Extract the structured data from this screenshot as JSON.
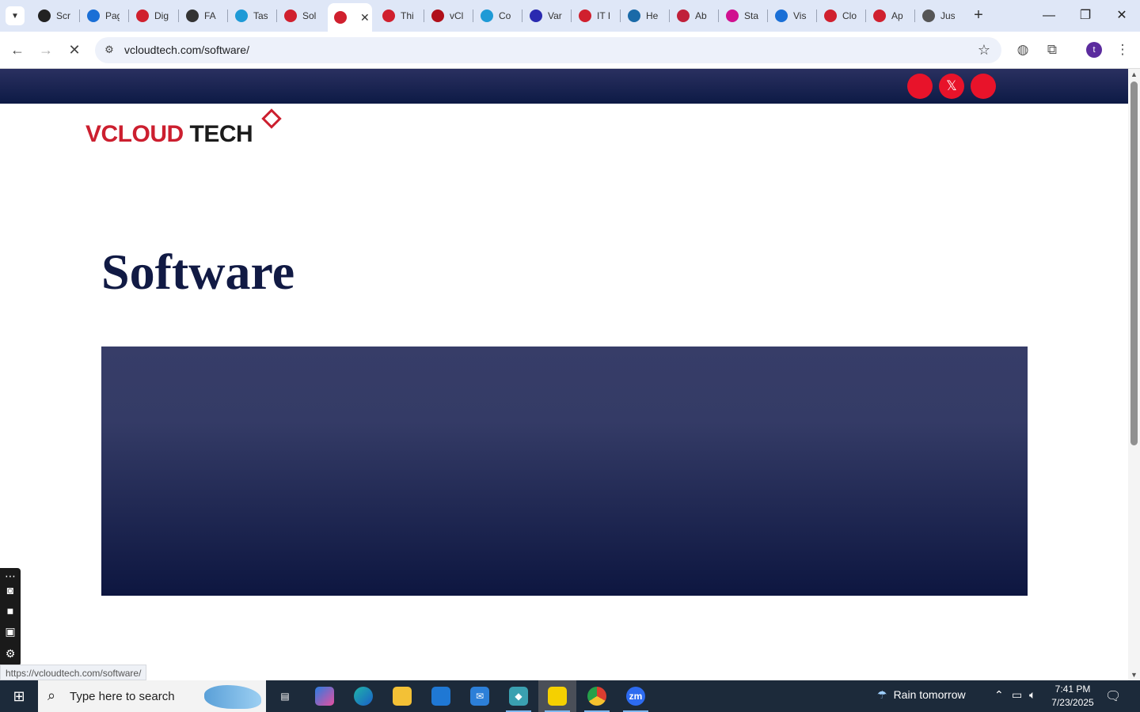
{
  "browser": {
    "tabs": [
      {
        "label": "Scr",
        "color": "#222"
      },
      {
        "label": "Pag",
        "color": "#1a6fd6"
      },
      {
        "label": "Dig",
        "color": "#d0202e"
      },
      {
        "label": "FA",
        "color": "#333"
      },
      {
        "label": "Tas",
        "color": "#1e9ad6"
      },
      {
        "label": "Sol",
        "color": "#d0202e"
      },
      {
        "label": "",
        "color": "#d0202e",
        "active": true
      },
      {
        "label": "Thi",
        "color": "#d0202e"
      },
      {
        "label": "vCl",
        "color": "#b0101a"
      },
      {
        "label": "Co",
        "color": "#1e9ad6"
      },
      {
        "label": "Var",
        "color": "#2a2ab0"
      },
      {
        "label": "IT I",
        "color": "#d0202e"
      },
      {
        "label": "He",
        "color": "#1a6aa8"
      },
      {
        "label": "Ab",
        "color": "#c0203a"
      },
      {
        "label": "Sta",
        "color": "#d01090"
      },
      {
        "label": "Vis",
        "color": "#1a6fd6"
      },
      {
        "label": "Clo",
        "color": "#d0202e"
      },
      {
        "label": "Ap",
        "color": "#d0202e"
      },
      {
        "label": "Jus",
        "color": "#555"
      }
    ],
    "url": "vcloudtech.com/software/",
    "profile_initial": "t",
    "hover_url": "https://vcloudtech.com/software/"
  },
  "page": {
    "logo_part1": "VCLOUD",
    "logo_part2": " TECH",
    "title": "Software",
    "social_x": "𝕏"
  },
  "taskbar": {
    "search_placeholder": "Type here to search",
    "weather": "Rain tomorrow",
    "time": "7:41 PM",
    "date": "7/23/2025"
  }
}
